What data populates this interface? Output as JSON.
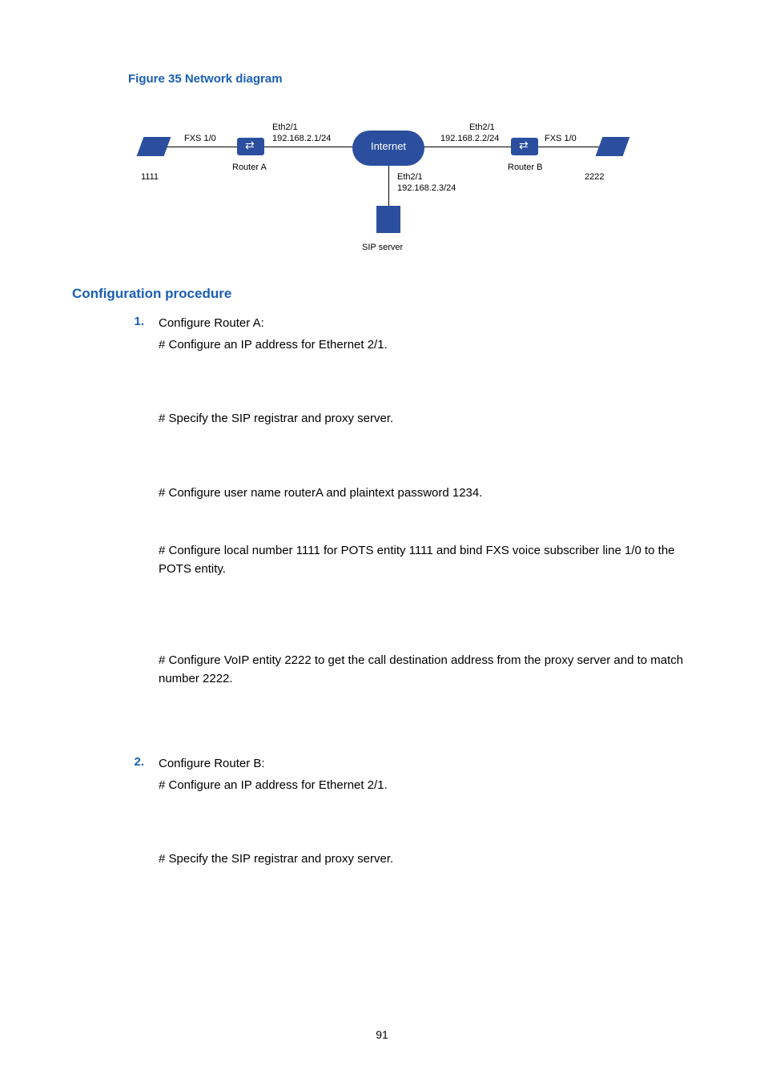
{
  "figure": {
    "caption": "Figure 35 Network diagram",
    "left_phone": "1111",
    "right_phone": "2222",
    "left_fxs": "FXS 1/0",
    "right_fxs": "FXS 1/0",
    "routerA_label": "Router A",
    "routerB_label": "Router B",
    "routerA_eth": "Eth2/1",
    "routerA_ip": "192.168.2.1/24",
    "routerB_eth": "Eth2/1",
    "routerB_ip": "192.168.2.2/24",
    "internet": "Internet",
    "server_eth": "Eth2/1",
    "server_ip": "192.168.2.3/24",
    "server_label": "SIP server"
  },
  "heading": "Configuration procedure",
  "items": [
    {
      "num": "1.",
      "first": "Configure Router A:",
      "steps": [
        "# Configure an IP address for Ethernet 2/1.",
        "# Specify the SIP registrar and proxy server.",
        "# Configure user name routerA and plaintext password 1234.",
        "# Configure local number 1111 for POTS entity 1111 and bind FXS voice subscriber line 1/0 to the POTS entity.",
        "# Configure VoIP entity 2222 to get the call destination address from the proxy server and to match number 2222."
      ]
    },
    {
      "num": "2.",
      "first": "Configure Router B:",
      "steps": [
        "# Configure an IP address for Ethernet 2/1.",
        "# Specify the SIP registrar and proxy server."
      ]
    }
  ],
  "pagenum": "91"
}
